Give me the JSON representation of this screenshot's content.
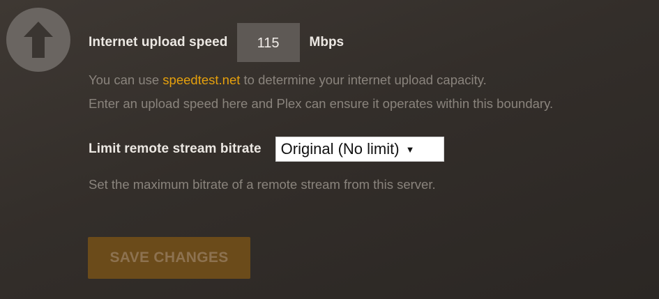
{
  "upload_icon": "arrow-up-icon",
  "upload_speed": {
    "label": "Internet upload speed",
    "value": "115",
    "unit": "Mbps"
  },
  "help": {
    "line1_before": "You can use ",
    "line1_link": "speedtest.net",
    "line1_after": " to determine your internet upload capacity.",
    "line2": "Enter an upload speed here and Plex can ensure it operates within this boundary."
  },
  "bitrate": {
    "label": "Limit remote stream bitrate",
    "selected": "Original (No limit)",
    "help": "Set the maximum bitrate of a remote stream from this server."
  },
  "save_button": {
    "label": "SAVE CHANGES"
  },
  "colors": {
    "accent": "#e5a00d",
    "background": "#332e2a",
    "button_disabled": "#6b4b1a"
  }
}
